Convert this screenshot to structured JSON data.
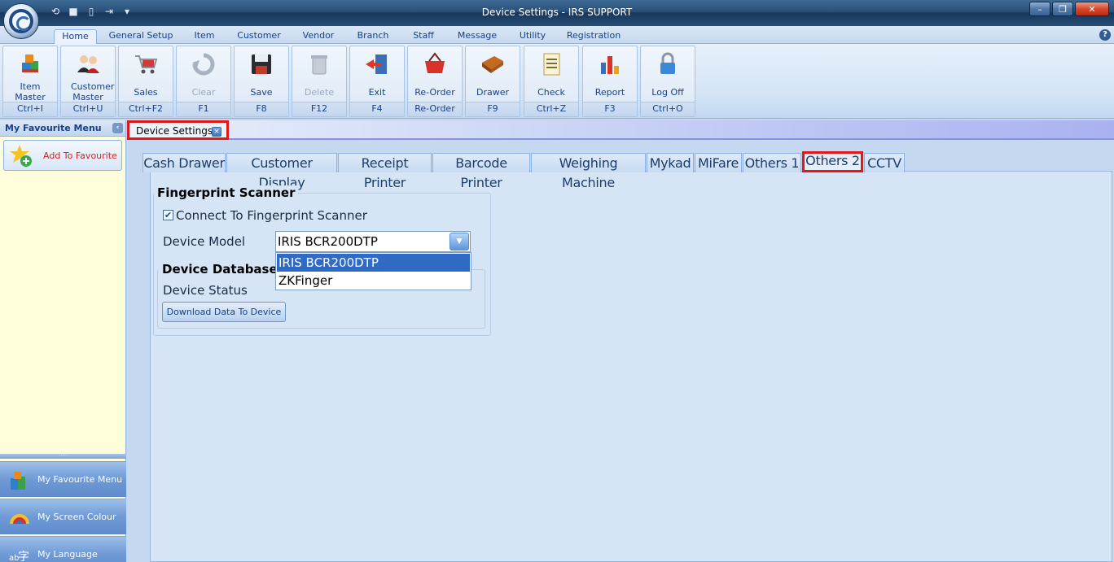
{
  "window": {
    "title": "Device Settings - IRS SUPPORT"
  },
  "ribbon_tabs": [
    "Home",
    "General Setup",
    "Item",
    "Customer",
    "Vendor",
    "Branch",
    "Staff",
    "Message",
    "Utility",
    "Registration"
  ],
  "ribbon_buttons": [
    {
      "label": "Item Master",
      "shortcut": "Ctrl+I",
      "icon": "item-master-icon"
    },
    {
      "label": "Customer Master",
      "shortcut": "Ctrl+U",
      "icon": "customer-master-icon"
    },
    {
      "label": "Sales",
      "shortcut": "Ctrl+F2",
      "icon": "cart-icon"
    },
    {
      "label": "Clear",
      "shortcut": "F1",
      "icon": "clear-icon",
      "disabled": true
    },
    {
      "label": "Save",
      "shortcut": "F8",
      "icon": "floppy-icon"
    },
    {
      "label": "Delete",
      "shortcut": "F12",
      "icon": "trash-icon",
      "disabled": true
    },
    {
      "label": "Exit",
      "shortcut": "F4",
      "icon": "exit-door-icon"
    },
    {
      "label": "Re-Order",
      "shortcut": "Re-Order",
      "icon": "basket-icon"
    },
    {
      "label": "Drawer",
      "shortcut": "F9",
      "icon": "drawer-icon"
    },
    {
      "label": "Check",
      "shortcut": "Ctrl+Z",
      "icon": "checklist-icon"
    },
    {
      "label": "Report",
      "shortcut": "F3",
      "icon": "report-chart-icon"
    },
    {
      "label": "Log Off",
      "shortcut": "Ctrl+O",
      "icon": "padlock-icon"
    }
  ],
  "sidebar": {
    "title": "My Favourite Menu",
    "add_favourite": "Add To Favourite",
    "nav": [
      {
        "label": "My Favourite Menu",
        "icon": "favourite-menu-icon"
      },
      {
        "label": "My Screen Colour",
        "icon": "palette-icon"
      },
      {
        "label": "My Language",
        "icon": "language-icon"
      }
    ]
  },
  "document_tab": {
    "label": "Device Settings"
  },
  "device_tabs": [
    "Cash Drawer",
    "Customer Display",
    "Receipt Printer",
    "Barcode Printer",
    "Weighing Machine",
    "Mykad",
    "MiFare",
    "Others 1",
    "Others 2",
    "CCTV"
  ],
  "active_device_tab": "Others 2",
  "fingerprint": {
    "group_title": "Fingerprint Scanner",
    "connect_label": "Connect To Fingerprint Scanner",
    "connect_checked": true,
    "model_label": "Device Model",
    "model_value": "IRIS BCR200DTP",
    "model_options": [
      "IRIS BCR200DTP",
      "ZKFinger"
    ],
    "database_title": "Device Database",
    "status_label": "Device Status",
    "download_button": "Download Data To Device"
  },
  "colors": {
    "highlight": "#e01818",
    "selection": "#316ac5",
    "sidebar_bg": "#fffedb"
  }
}
